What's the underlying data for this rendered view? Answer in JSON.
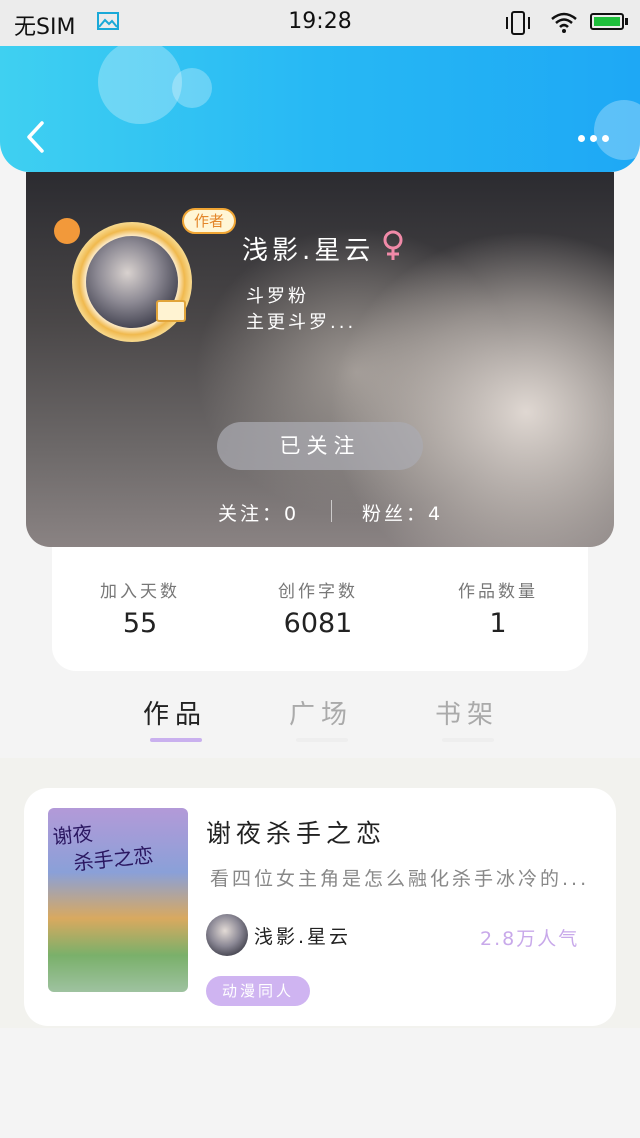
{
  "status_bar": {
    "carrier": "无SIM",
    "time": "19:28"
  },
  "header": {
    "back_icon": "chevron-left-icon",
    "more_icon": "more-dots-icon"
  },
  "profile": {
    "author_tag": "作者",
    "username": "浅影.星云",
    "gender_symbol": "♀",
    "bio_line1": "斗罗粉",
    "bio_line2": "主更斗罗...",
    "follow_button": "已关注",
    "following_text": "关注：0",
    "fans_text": "粉丝：4"
  },
  "stats": {
    "days_label": "加入天数",
    "days_value": "55",
    "words_label": "创作字数",
    "words_value": "6081",
    "works_label": "作品数量",
    "works_value": "1"
  },
  "tabs": [
    {
      "label": "作品",
      "active": true
    },
    {
      "label": "广场",
      "active": false
    },
    {
      "label": "书架",
      "active": false
    }
  ],
  "works": [
    {
      "cover_text_line1": "谢夜",
      "cover_text_line2": "杀手之恋",
      "title": "谢夜杀手之恋",
      "description": "看四位女主角是怎么融化杀手冰冷的...",
      "author": "浅影.星云",
      "popularity": "2.8万人气",
      "genre": "动漫同人"
    }
  ],
  "colors": {
    "header_start": "#3fd0f1",
    "header_end": "#1ea8f5",
    "accent": "#c9b0ee"
  }
}
